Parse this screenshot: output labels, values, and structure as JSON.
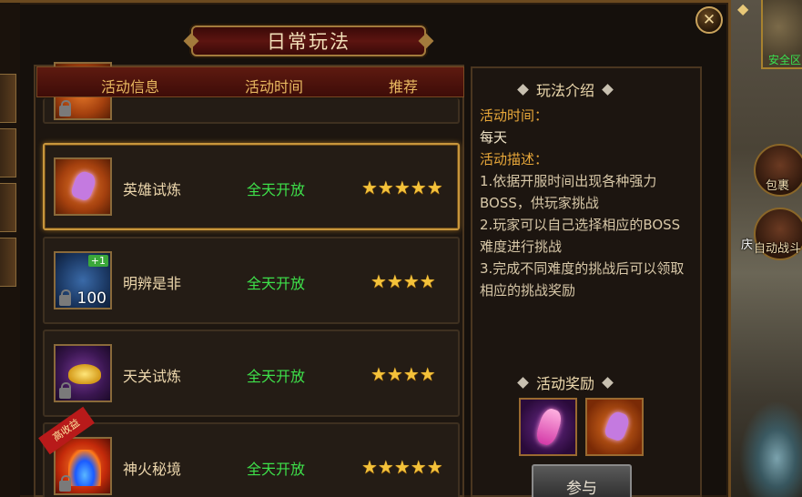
{
  "window": {
    "title": "日常玩法",
    "close_icon": "close-icon"
  },
  "world": {
    "minimap_label": "安全区",
    "buttons": [
      {
        "label": "包裹",
        "icon": "bag-icon"
      },
      {
        "label": "自动战斗",
        "icon": "auto-battle-icon"
      }
    ],
    "side_text": "庆"
  },
  "list": {
    "headers": [
      "活动信息",
      "活动时间",
      "推荐"
    ],
    "rows": [
      {
        "name": "英雄试炼",
        "time": "全天开放",
        "stars": "★★★★★",
        "icon": "purple-crystal-icon",
        "selected": true
      },
      {
        "name": "明辨是非",
        "time": "全天开放",
        "stars": "★★★★",
        "icon": "blue-scroll-icon",
        "badge": "+1",
        "count": "100"
      },
      {
        "name": "天关试炼",
        "time": "全天开放",
        "stars": "★★★★",
        "icon": "gold-ingot-icon"
      },
      {
        "name": "神火秘境",
        "time": "全天开放",
        "stars": "★★★★★",
        "icon": "blue-fire-icon",
        "ribbon": "高收益"
      }
    ]
  },
  "info": {
    "intro_title": "玩法介绍",
    "time_label": "活动时间：",
    "time_value": "每天",
    "desc_label": "活动描述：",
    "desc_lines": [
      "1.依据开服时间出现各种强力BOSS，供玩家挑战",
      "2.玩家可以自己选择相应的BOSS难度进行挑战",
      "3.完成不同难度的挑战后可以领取相应的挑战奖励"
    ],
    "reward_title": "活动奖励",
    "join_label": "参与"
  },
  "colors": {
    "accent_gold": "#e9a83a",
    "time_green": "#3ee04a",
    "star_gold": "#f4c23a"
  }
}
